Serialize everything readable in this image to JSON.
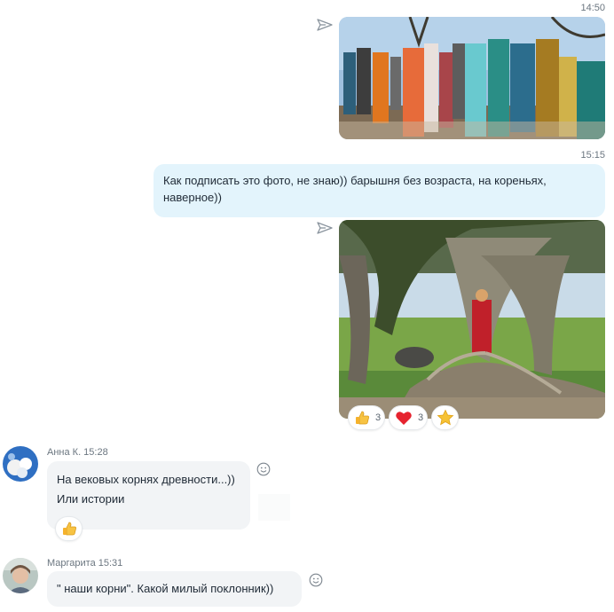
{
  "messages": {
    "photo1_time": "14:50",
    "text_time": "15:15",
    "text_line1": "Как подписать это фото, не знаю)) барышня без возраста, на кореньях,",
    "text_line2": "наверное))",
    "photo2_reactions": [
      {
        "icon": "thumbs-up-icon",
        "count": "3"
      },
      {
        "icon": "heart-icon",
        "count": "3"
      },
      {
        "icon": "star-icon",
        "count": ""
      }
    ]
  },
  "anna": {
    "author": "Анна К. 15:28",
    "line1": "На вековых корнях древности...))",
    "line2": "Или истории",
    "reaction_icon": "thumbs-up-icon"
  },
  "margarita": {
    "author": "Маргарита 15:31",
    "text": "\" наши корни\". Какой милый поклонник))"
  },
  "colors": {
    "outgoing_bubble": "#e3f4fc",
    "incoming_bubble": "#f2f4f6",
    "meta_text": "#6b7680"
  }
}
